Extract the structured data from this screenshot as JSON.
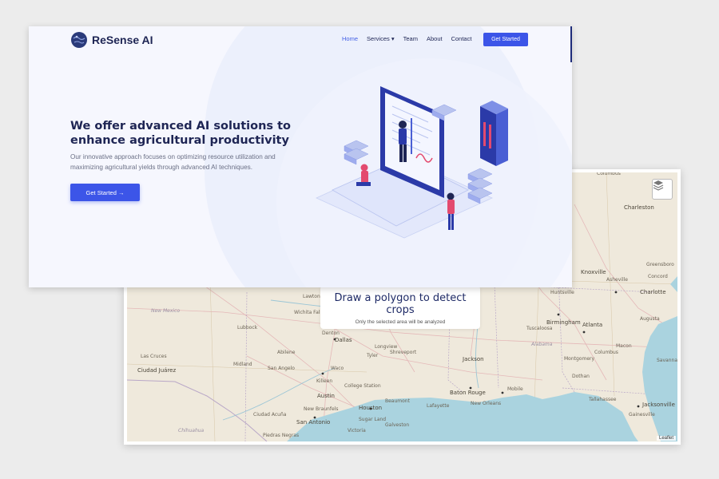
{
  "site": {
    "brand": "ReSense AI",
    "nav": [
      {
        "label": "Home",
        "active": true
      },
      {
        "label": "Services ▾",
        "active": false
      },
      {
        "label": "Team",
        "active": false
      },
      {
        "label": "About",
        "active": false
      },
      {
        "label": "Contact",
        "active": false
      }
    ],
    "cta_top": "Get Started",
    "hero_title": "We offer advanced AI solutions to enhance agricultural productivity",
    "hero_desc": "Our innovative approach focuses on optimizing resource utilization and maximizing agricultural yields through advanced AI techniques.",
    "hero_button": "Get Started →",
    "accent": "#3c55e8",
    "ink": "#1e2554"
  },
  "map": {
    "overlay_title": "Draw a polygon to detect crops",
    "overlay_subtitle": "Only the selected area will be analyzed",
    "attribution": "Leaflet",
    "layers_icon": "layers-icon",
    "water_color": "#aad3df",
    "land_color": "#efe9dc",
    "labels": [
      "Columbus",
      "Charleston",
      "Knoxville",
      "Asheville",
      "Greensboro",
      "Charlotte",
      "Concord",
      "Huntsville",
      "Birmingham",
      "Atlanta",
      "Augusta",
      "Tuscaloosa",
      "Alabama",
      "Columbus",
      "Macon",
      "Montgomery",
      "Savannah",
      "Dothan",
      "Tallahassee",
      "Jacksonville",
      "Gainesville",
      "Mobile",
      "New Orleans",
      "Baton Rouge",
      "Lafayette",
      "Beaumont",
      "Houston",
      "Sugar Land",
      "Galveston",
      "Jackson",
      "Shreveport",
      "Tyler",
      "Longview",
      "Dallas",
      "Waco",
      "Killeen",
      "College Station",
      "Austin",
      "New Braunfels",
      "San Antonio",
      "Victoria",
      "Ciudad Acuña",
      "Piedras Negras",
      "Lubbock",
      "Abilene",
      "Midland",
      "San Angelo",
      "Lawton",
      "Wichita Falls",
      "Denton",
      "New Mexico",
      "Las Cruces",
      "Ciudad Juárez",
      "Chihuahua"
    ]
  }
}
